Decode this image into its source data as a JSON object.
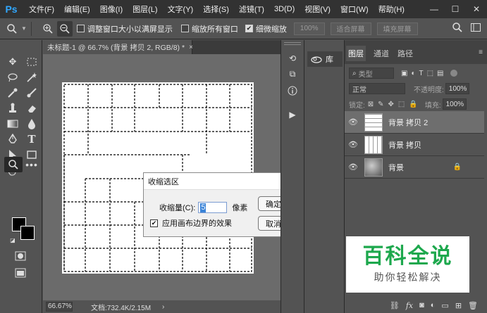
{
  "app": {
    "logo": "Ps"
  },
  "menu": [
    "文件(F)",
    "编辑(E)",
    "图像(I)",
    "图层(L)",
    "文字(Y)",
    "选择(S)",
    "滤镜(T)",
    "3D(D)",
    "视图(V)",
    "窗口(W)",
    "帮助(H)"
  ],
  "window_controls": [
    "—",
    "☐",
    "✕"
  ],
  "options": {
    "resize_windows": "调整窗口大小以满屏显示",
    "zoom_all_windows": "缩放所有窗口",
    "scrubby_zoom": "细微缩放",
    "resize_windows_checked": false,
    "zoom_all_windows_checked": false,
    "scrubby_zoom_checked": true,
    "zoom_100": "100%",
    "fit_screen": "适合屏幕",
    "fill_screen": "填充屏幕"
  },
  "document": {
    "tab_title": "未标题-1 @ 66.7% (背景 拷贝 2, RGB/8) *",
    "tab_close": "×",
    "zoom": "66.67%",
    "doc_size": "文档:732.4K/2.15M",
    "status_arrow": "›"
  },
  "dialog": {
    "title": "收缩选区",
    "close": "✕",
    "amount_label": "收缩量(C):",
    "amount_value": "5",
    "unit": "像素",
    "apply_canvas_bounds": "应用画布边界的效果",
    "apply_canvas_bounds_checked": true,
    "ok": "确定",
    "cancel": "取消"
  },
  "library": {
    "label": "库"
  },
  "layers_panel": {
    "tabs": [
      "图层",
      "通道",
      "路径"
    ],
    "active_tab": 0,
    "kind_filter": "类型",
    "blend_mode": "正常",
    "opacity_label": "不透明度:",
    "opacity_value": "100%",
    "lock_label": "锁定:",
    "fill_label": "填充:",
    "fill_value": "100%",
    "layers": [
      {
        "name": "背景 拷贝 2",
        "selected": true,
        "locked": false
      },
      {
        "name": "背景 拷贝",
        "selected": false,
        "locked": false
      },
      {
        "name": "背景",
        "selected": false,
        "locked": true
      }
    ],
    "footer_icons": [
      "link-icon",
      "fx-icon",
      "mask-icon",
      "adjustment-icon",
      "group-icon",
      "new-layer-icon",
      "trash-icon"
    ]
  },
  "watermark": {
    "title": "百科全说",
    "subtitle": "助你轻松解决"
  },
  "colors": {
    "accent": "#31a8ff",
    "selection": "#3b84d8",
    "watermark_green": "#1da84d"
  }
}
